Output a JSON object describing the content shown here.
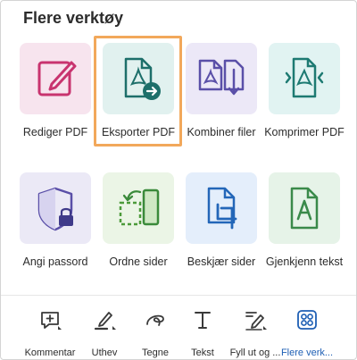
{
  "panel": {
    "title": "Flere verktøy"
  },
  "tools": [
    {
      "name": "Rediger PDF",
      "icon": "edit-pencil-icon",
      "bg": "#f7e4ee"
    },
    {
      "name": "Eksporter PDF",
      "icon": "export-pdf-icon",
      "bg": "#e1f1ef",
      "selected": true
    },
    {
      "name": "Kombiner filer",
      "icon": "combine-files-icon",
      "bg": "#ece8f7"
    },
    {
      "name": "Komprimer PDF",
      "icon": "compress-pdf-icon",
      "bg": "#e1f3f2"
    },
    {
      "name": "Angi passord",
      "icon": "password-shield-icon",
      "bg": "#ebe9f6"
    },
    {
      "name": "Ordne sider",
      "icon": "organize-pages-icon",
      "bg": "#ebf5e6"
    },
    {
      "name": "Beskjær sider",
      "icon": "crop-pages-icon",
      "bg": "#e4eefb"
    },
    {
      "name": "Gjenkjenn tekst",
      "icon": "recognize-text-icon",
      "bg": "#e6f3e8"
    }
  ],
  "toolbar": {
    "items": [
      {
        "label": "Kommentar",
        "icon": "comment-icon"
      },
      {
        "label": "Uthev",
        "icon": "highlight-icon"
      },
      {
        "label": "Tegne",
        "icon": "draw-icon"
      },
      {
        "label": "Tekst",
        "icon": "text-icon"
      },
      {
        "label": "Fyll ut og ...",
        "icon": "fill-sign-icon"
      },
      {
        "label": "Flere verk...",
        "icon": "more-tools-icon",
        "active": true
      }
    ]
  },
  "colors": {
    "accent_blue": "#1e5fb4",
    "selection_orange": "#f2a85b",
    "pink_icon": "#c8346f",
    "teal_icon": "#1d6f6a",
    "purple_icon": "#5a4fa8",
    "green_icon": "#3a8a3a",
    "blue_icon": "#2366b8"
  }
}
